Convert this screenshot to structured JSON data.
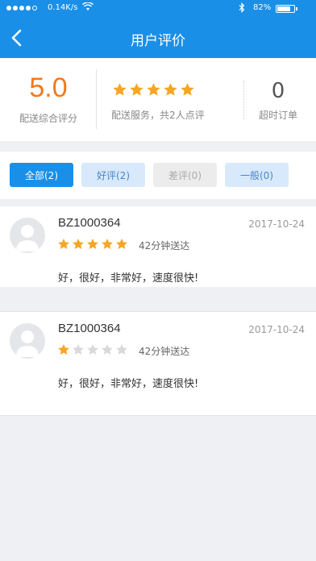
{
  "status_bar": {
    "speed": "0.14K/s",
    "battery": "82%",
    "battery_level": 0.82
  },
  "nav": {
    "title": "用户评价",
    "back_icon": "chevron-left-icon"
  },
  "summary": {
    "score": "5.0",
    "score_label": "配送综合评分",
    "rating_stars": 5,
    "rating_desc": "配送服务，共2人点评",
    "overtime_count": "0",
    "overtime_label": "超时订单"
  },
  "filters": [
    {
      "label": "全部(2)",
      "active": true
    },
    {
      "label": "好评(2)",
      "active": false
    },
    {
      "label": "差评(0)",
      "active": false
    },
    {
      "label": "一般(0)",
      "active": false
    }
  ],
  "reviews": [
    {
      "user": "BZ1000364",
      "date": "2017-10-24",
      "rating": 5,
      "delivery_time": "42分钟送达",
      "comment": "好，很好，非常好，速度很快!"
    },
    {
      "user": "BZ1000364",
      "date": "2017-10-24",
      "rating": 1,
      "delivery_time": "42分钟送达",
      "comment": "好，很好，非常好，速度很快!"
    }
  ],
  "colors": {
    "primary": "#1a8fe8",
    "score": "#f07a1e",
    "star_filled": "#f5a623",
    "star_empty": "#d9d9d9"
  }
}
